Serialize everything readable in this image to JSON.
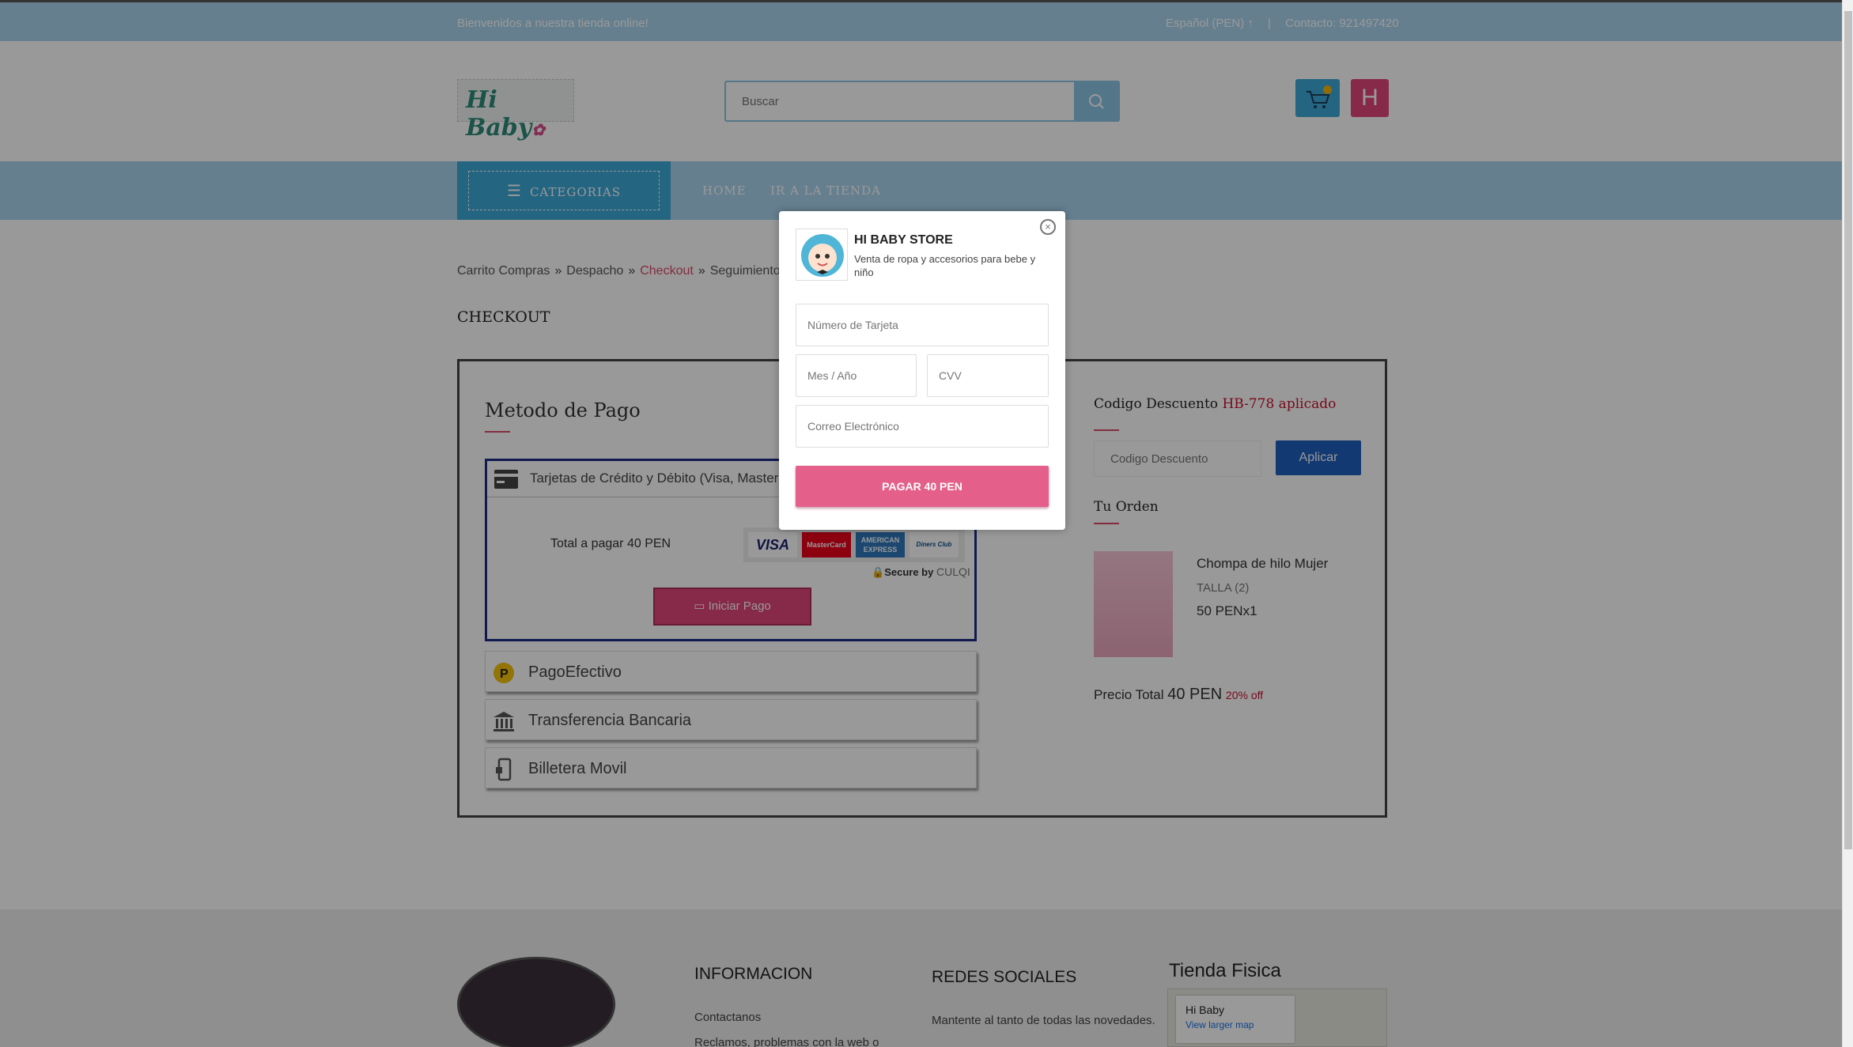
{
  "topbar": {
    "welcome": "Bienvenidos a nuestra tienda online!",
    "language": "Español (PEN) ↑",
    "separator": "|",
    "contact": "Contacto: 921497420"
  },
  "header": {
    "logo_text": "Hi Baby",
    "search_placeholder": "Buscar",
    "avatar_letter": "H"
  },
  "nav": {
    "categories": "CATEGORIAS",
    "home": "HOME",
    "store": "IR A LA TIENDA"
  },
  "breadcrumb": {
    "items": [
      "Carrito Compras",
      "Despacho",
      "Checkout",
      "Seguimiento P"
    ],
    "separator": "»"
  },
  "page": {
    "title": "CHECKOUT"
  },
  "payment": {
    "title": "Metodo de Pago",
    "card_option_label": "Tarjetas de Crédito y Débito (Visa, Masterc",
    "total_text": "Total a pagar 40 PEN",
    "brands": [
      "VISA",
      "MasterCard",
      "AMERICAN EXPRESS",
      "Diners Club"
    ],
    "secure_by": "Secure by",
    "secure_brand": "CULQI",
    "start_button": "Iniciar Pago",
    "options": [
      "PagoEfectivo",
      "Transferencia Bancaria",
      "Billetera Movil"
    ]
  },
  "order": {
    "discount_label": "Codigo Descuento",
    "discount_applied": "HB-778 aplicado",
    "discount_placeholder": "Codigo Descuento",
    "apply_button": "Aplicar",
    "your_order": "Tu Orden",
    "product_name": "Chompa de hilo Mujer",
    "product_size": "TALLA (2)",
    "product_price": "50 PEN",
    "product_qty": "x1",
    "total_label": "Precio Total",
    "total_value": "40 PEN",
    "discount_pct": "20% off"
  },
  "footer": {
    "info_title": "INFORMACION",
    "info_links": [
      "Contactanos",
      "Reclamos, problemas con la web o"
    ],
    "social_title": "REDES SOCIALES",
    "social_text": "Mantente al tanto de todas las novedades.",
    "store_title": "Tienda Fisica",
    "map_name": "Hi Baby",
    "map_link": "View larger map"
  },
  "modal": {
    "store_name": "HI BABY STORE",
    "store_desc": "Venta de ropa y accesorios para bebe y niño",
    "card_number_placeholder": "Número de Tarjeta",
    "expiry_placeholder": "Mes / Año",
    "cvv_placeholder": "CVV",
    "email_placeholder": "Correo Electrónico",
    "pay_button": "PAGAR 40 PEN",
    "close": "×"
  },
  "colors": {
    "accent_blue": "#3da8d8",
    "light_blue": "#a9d4ee",
    "pink": "#e2457a",
    "apply_blue": "#1f5fbf",
    "discount_red": "#c8102e"
  }
}
